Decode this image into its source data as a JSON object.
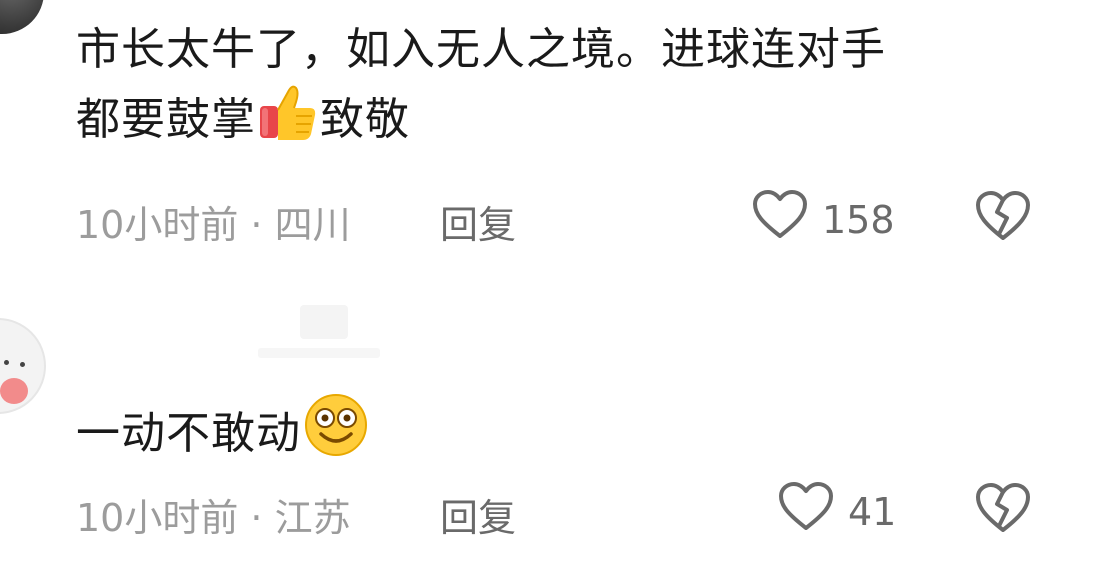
{
  "comments": [
    {
      "text_line1": "市长太牛了，如入无人之境。进球连对手",
      "text_line2_before_emoji": "都要鼓掌",
      "text_line2_emoji": "thumbs-up-emoji",
      "text_line2_after_emoji": "致敬",
      "time_location": "10小时前 · 四川",
      "reply_label": "回复",
      "like_count": "158"
    },
    {
      "text_before_emoji": "一动不敢动",
      "text_emoji": "smiling-face-emoji",
      "time_location": "10小时前 · 江苏",
      "reply_label": "回复",
      "like_count": "41"
    }
  ],
  "colors": {
    "text": "#1a1a1a",
    "meta": "#9c9c9c",
    "action": "#6a6a6a",
    "background": "#ffffff"
  }
}
